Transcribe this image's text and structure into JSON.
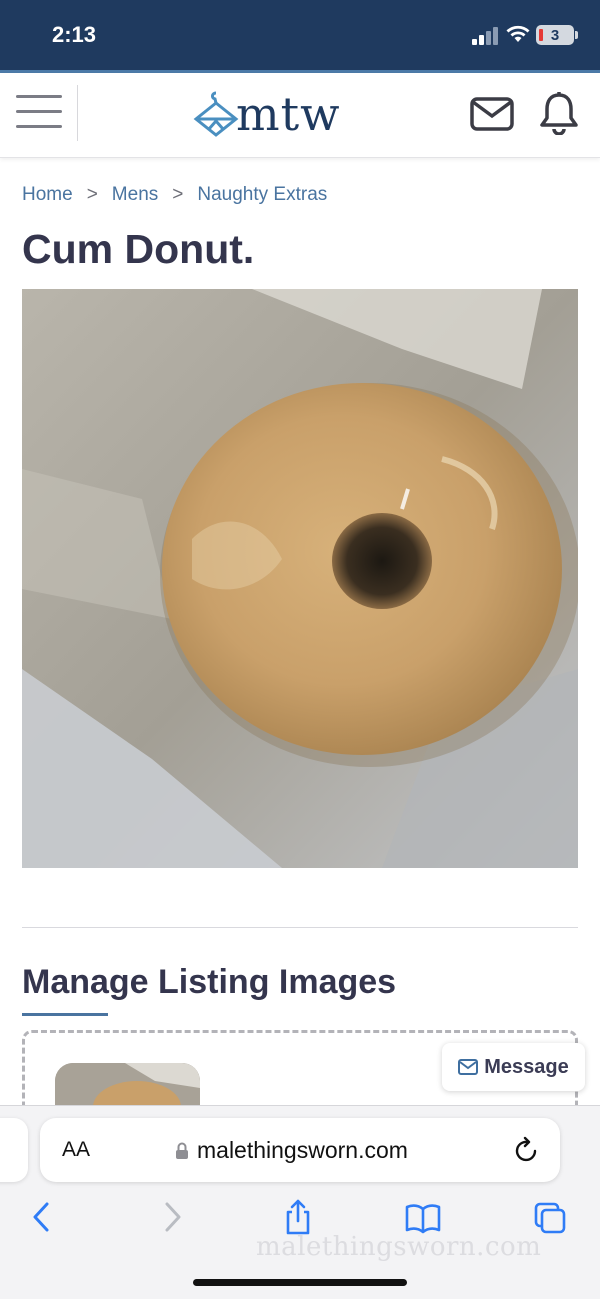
{
  "status_bar": {
    "time": "2:13",
    "battery_level": "3"
  },
  "header": {
    "logo_text": "mtw",
    "brand_color": "#1f3a5f",
    "icons": [
      "hamburger-menu-icon",
      "hanger-logo-icon",
      "mail-icon",
      "bell-icon"
    ]
  },
  "breadcrumb": {
    "items": [
      "Home",
      "Mens",
      "Naughty Extras"
    ],
    "separator": ">"
  },
  "listing": {
    "title": "Cum Donut."
  },
  "manage_images": {
    "heading": "Manage Listing Images"
  },
  "message_button": {
    "label": "Message"
  },
  "safari": {
    "text_size_label": "AA",
    "url": "malethingsworn.com",
    "toolbar_icons": [
      "back-icon",
      "forward-icon",
      "share-icon",
      "bookmarks-icon",
      "tabs-icon"
    ],
    "accent_color": "#2f7cf6"
  },
  "watermark": {
    "text": "malethingsworn.com"
  }
}
